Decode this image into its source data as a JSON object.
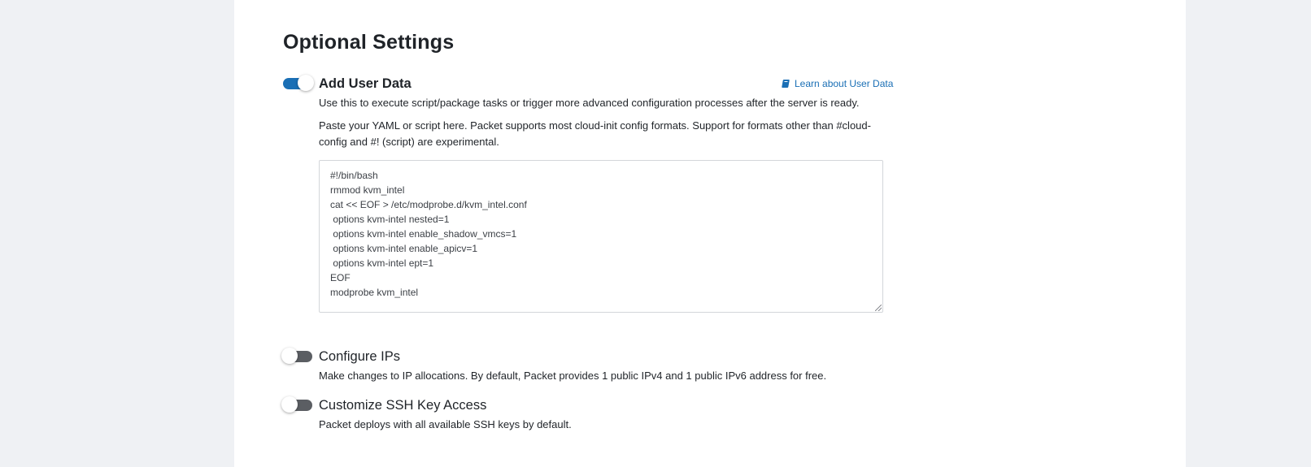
{
  "section_title": "Optional Settings",
  "colors": {
    "accent": "#1a6fb5",
    "toggle_off": "#5b5e63",
    "page_background": "#eff1f4"
  },
  "user_data": {
    "enabled": true,
    "title": "Add User Data",
    "learn_link": "Learn about User Data",
    "learn_link_icon": "book-icon",
    "description": "Use this to execute script/package tasks or trigger more advanced configuration processes after the server is ready.",
    "paste_note": "Paste your YAML or script here. Packet supports most cloud-init config formats. Support for formats other than #cloud-config and #! (script) are experimental.",
    "script_lines": [
      "#!/bin/bash",
      "rmmod kvm_intel",
      "cat << EOF > /etc/modprobe.d/kvm_intel.conf",
      " options kvm-intel nested=1",
      " options kvm-intel enable_shadow_vmcs=1",
      " options kvm-intel enable_apicv=1",
      " options kvm-intel ept=1",
      "EOF",
      "modprobe kvm_intel"
    ]
  },
  "configure_ips": {
    "enabled": false,
    "title": "Configure IPs",
    "description": "Make changes to IP allocations. By default, Packet provides 1 public IPv4 and 1 public IPv6 address for free."
  },
  "ssh_keys": {
    "enabled": false,
    "title": "Customize SSH Key Access",
    "description": "Packet deploys with all available SSH keys by default."
  }
}
